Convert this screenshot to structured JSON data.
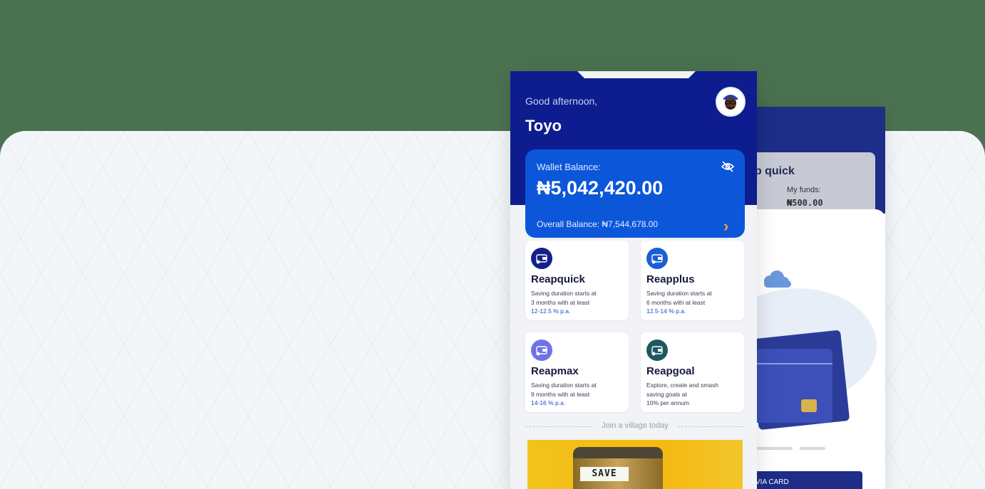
{
  "header": {
    "greeting": "Good afternoon,",
    "user_name": "Toyo"
  },
  "wallet": {
    "label": "Wallet Balance:",
    "amount": "₦5,042,420.00",
    "overall": "Overall Balance:  ₦7,544,678.00"
  },
  "plans": [
    {
      "title": "Reapquick",
      "line1": "Saving duration starts at",
      "line2": "3 months with at least",
      "rate": "12-12.5 % p.a.",
      "icon_color": "#12208a"
    },
    {
      "title": "Reapplus",
      "line1": "Saving duration starts at",
      "line2": "6 months with at least",
      "rate": "12.5-14 % p.a.",
      "icon_color": "#1b5fd6"
    },
    {
      "title": "Reapmax",
      "line1": "Saving duration starts at",
      "line2": "9 months with at least",
      "rate": "14-16 % p.a.",
      "icon_color": "#6f73e6"
    },
    {
      "title": "Reapgoal",
      "line1": "Explore, create and smash",
      "line2": "saving goals at",
      "rate": "10% per annum",
      "icon_color": "#1c5960"
    }
  ],
  "village": {
    "divider_text": "Join a village today",
    "jar_label": "SAVE"
  },
  "back_screen": {
    "title": "ap quick",
    "funds_label": "My funds:",
    "funds_value": "₦500.00",
    "button_label": "VIA CARD"
  },
  "colors": {
    "header_blue": "#0d1d8f",
    "wallet_blue": "#0c57d9",
    "accent_orange": "#f4a536"
  },
  "icons": {
    "avatar": "avatar-image",
    "hide_balance": "eye-off-icon",
    "wallet_arrow": "chevron-right-icon",
    "plan_icon": "wallet-icon"
  }
}
